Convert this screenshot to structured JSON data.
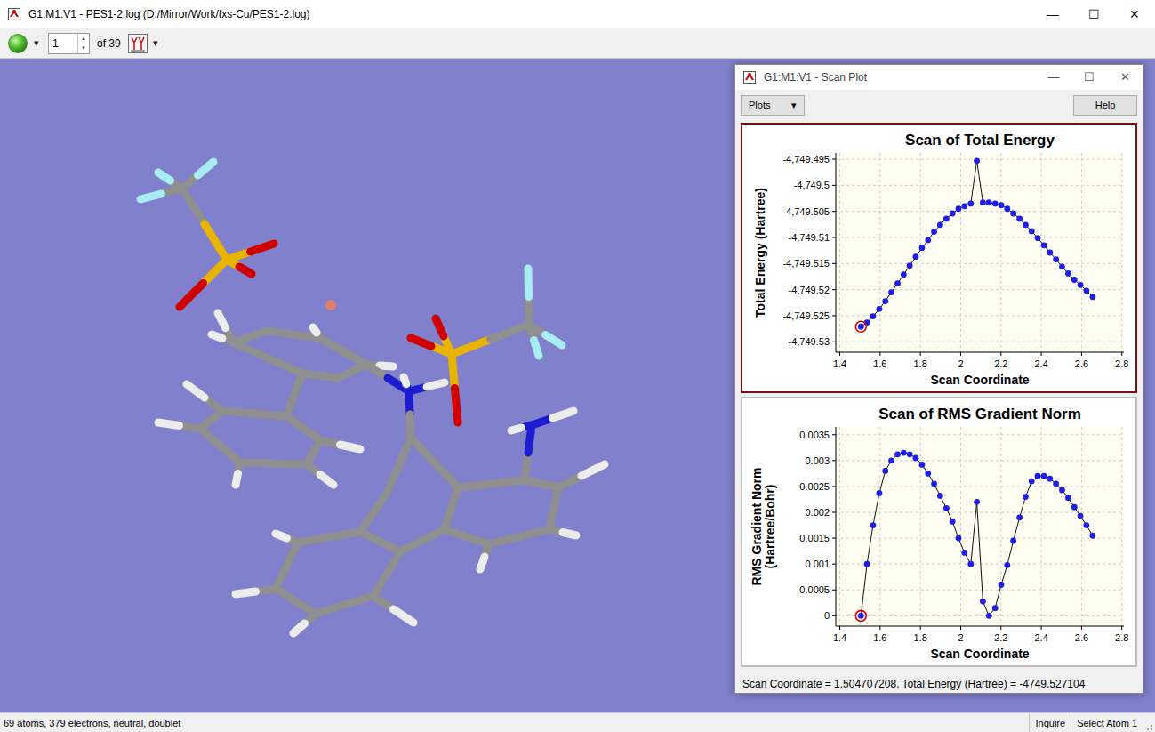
{
  "window": {
    "title": "G1:M1:V1 - PES1-2.log (D:/Mirror/Work/fxs-Cu/PES1-2.log)",
    "controls": [
      "—",
      "☐",
      "✕"
    ]
  },
  "toolbar": {
    "ball_menu": "▾",
    "frame": "1",
    "spin_up": "▲",
    "spin_down": "▼",
    "of_label": "of 39",
    "mode_menu": "▾"
  },
  "plot_window": {
    "title": "G1:M1:V1 - Scan Plot",
    "controls": [
      "—",
      "☐",
      "✕"
    ],
    "plots_button": {
      "label": "Plots",
      "arrow": "▾"
    },
    "help_button": "Help",
    "scan_coordinates": [
      1.505,
      1.535,
      1.565,
      1.596,
      1.626,
      1.656,
      1.687,
      1.717,
      1.747,
      1.777,
      1.808,
      1.838,
      1.868,
      1.898,
      1.929,
      1.959,
      1.989,
      2.019,
      2.05,
      2.08,
      2.11,
      2.14,
      2.171,
      2.201,
      2.231,
      2.261,
      2.292,
      2.322,
      2.352,
      2.382,
      2.413,
      2.443,
      2.473,
      2.503,
      2.534,
      2.564,
      2.594,
      2.624,
      2.655
    ],
    "selected_point": 0,
    "charts": [
      {
        "title": "Scan of Total Energy",
        "selected": true,
        "y_label": [
          "Total Energy (Hartree)"
        ],
        "x_label": "Scan Coordinate",
        "y_axis": {
          "min": -4749.532,
          "max": -4749.4938,
          "ticks": [
            {
              "label": "-4,749.495",
              "value": -4749.495
            },
            {
              "label": "-4,749.5",
              "value": -4749.5
            },
            {
              "label": "-4,749.505",
              "value": -4749.505
            },
            {
              "label": "-4,749.51",
              "value": -4749.51
            },
            {
              "label": "-4,749.515",
              "value": -4749.515
            },
            {
              "label": "-4,749.52",
              "value": -4749.52
            },
            {
              "label": "-4,749.525",
              "value": -4749.525
            },
            {
              "label": "-4,749.53",
              "value": -4749.53
            }
          ]
        },
        "x_axis": {
          "min": 1.38,
          "max": 2.81,
          "ticks": [
            {
              "label": "1.4",
              "value": 1.4
            },
            {
              "label": "1.6",
              "value": 1.6
            },
            {
              "label": "1.8",
              "value": 1.8
            },
            {
              "label": "2",
              "value": 2.0
            },
            {
              "label": "2.2",
              "value": 2.2
            },
            {
              "label": "2.4",
              "value": 2.4
            },
            {
              "label": "2.6",
              "value": 2.6
            },
            {
              "label": "2.8",
              "value": 2.8
            }
          ]
        },
        "values": [
          -4749.5271,
          -4749.5263,
          -4749.5251,
          -4749.5237,
          -4749.5222,
          -4749.5205,
          -4749.5188,
          -4749.5171,
          -4749.5154,
          -4749.5137,
          -4749.512,
          -4749.5105,
          -4749.5089,
          -4749.5076,
          -4749.5064,
          -4749.5054,
          -4749.5045,
          -4749.504,
          -4749.5035,
          -4749.4953,
          -4749.5033,
          -4749.5033,
          -4749.5035,
          -4749.5038,
          -4749.5045,
          -4749.5054,
          -4749.5064,
          -4749.5076,
          -4749.5088,
          -4749.5101,
          -4749.5115,
          -4749.5129,
          -4749.5142,
          -4749.5156,
          -4749.5169,
          -4749.5181,
          -4749.5191,
          -4749.5202,
          -4749.5214
        ]
      },
      {
        "title": "Scan of RMS Gradient Norm",
        "selected": false,
        "y_label": [
          "RMS Gradient Norm",
          "(Hartree/Bohr)"
        ],
        "x_label": "Scan Coordinate",
        "y_axis": {
          "min": -0.0002,
          "max": 0.00365,
          "ticks": [
            {
              "label": "0.0035",
              "value": 0.0035
            },
            {
              "label": "0.003",
              "value": 0.003
            },
            {
              "label": "0.0025",
              "value": 0.0025
            },
            {
              "label": "0.002",
              "value": 0.002
            },
            {
              "label": "0.0015",
              "value": 0.0015
            },
            {
              "label": "0.001",
              "value": 0.001
            },
            {
              "label": "0.0005",
              "value": 0.0005
            },
            {
              "label": "0",
              "value": 0
            }
          ]
        },
        "x_axis": {
          "min": 1.38,
          "max": 2.81,
          "ticks": [
            {
              "label": "1.4",
              "value": 1.4
            },
            {
              "label": "1.6",
              "value": 1.6
            },
            {
              "label": "1.8",
              "value": 1.8
            },
            {
              "label": "2",
              "value": 2.0
            },
            {
              "label": "2.2",
              "value": 2.2
            },
            {
              "label": "2.4",
              "value": 2.4
            },
            {
              "label": "2.6",
              "value": 2.6
            },
            {
              "label": "2.8",
              "value": 2.8
            }
          ]
        },
        "values": [
          0,
          0.001,
          0.00175,
          0.00237,
          0.0028,
          0.003,
          0.00312,
          0.00315,
          0.00312,
          0.00305,
          0.00292,
          0.00275,
          0.00255,
          0.00232,
          0.00208,
          0.00182,
          0.0015,
          0.00122,
          0.001,
          0.0022,
          0.00028,
          0,
          0.00015,
          0.0006,
          0.00098,
          0.00145,
          0.0019,
          0.0023,
          0.0026,
          0.0027,
          0.0027,
          0.00265,
          0.00255,
          0.00243,
          0.00228,
          0.0021,
          0.00193,
          0.00175,
          0.00155
        ]
      }
    ],
    "readout": "Scan Coordinate = 1.504707208, Total Energy (Hartree) = -4749.527104"
  },
  "status_bar": {
    "summary": "69 atoms, 379 electrons, neutral, doublet",
    "mode": "Inquire",
    "hint": "Select Atom 1"
  }
}
